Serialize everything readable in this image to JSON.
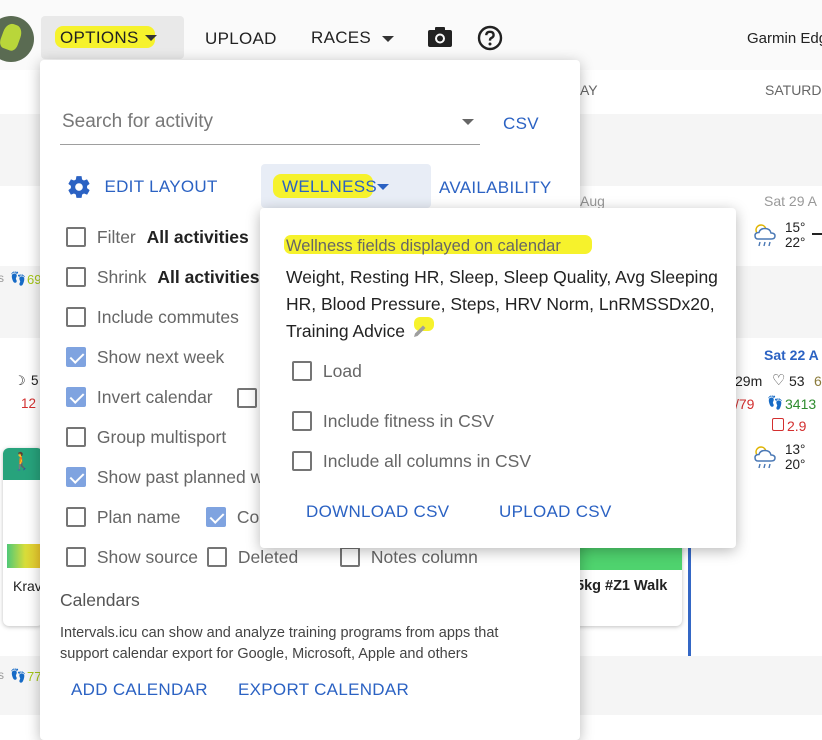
{
  "topbar": {
    "options_label": "OPTIONS",
    "upload_label": "UPLOAD",
    "races_label": "RACES",
    "device_label": "Garmin Edg"
  },
  "calendar": {
    "head_day": "AY",
    "head_saturday": "SATURD",
    "aug_label": "Aug",
    "sat29": "Sat 29 A",
    "temp_a1": "15°",
    "temp_a2": "22°",
    "sat22": "Sat 22 A",
    "row2_dur": "29m",
    "row2_hr": "53",
    "row2_6": "6",
    "row2_79": "/79",
    "row2_steps": "3413",
    "row2_29": "2.9",
    "temp_b1": "13°",
    "temp_b2": "20°",
    "left_5": "5",
    "left_12": "12",
    "left_69": "69",
    "left_77": "77",
    "left_krav": "Krav",
    "walk_label": "5kg #Z1 Walk"
  },
  "options": {
    "search_placeholder": "Search for activity",
    "csv_label": "CSV",
    "edit_layout_label": "EDIT LAYOUT",
    "wellness_label": "WELLNESS",
    "availability_label": "AVAILABILITY",
    "filter_label": "Filter",
    "filter_value": "All activities",
    "shrink_label": "Shrink",
    "shrink_value": "All activities",
    "include_commutes": "Include commutes",
    "show_next_week": "Show next week",
    "invert_calendar": "Invert calendar",
    "group_multisport": "Group multisport",
    "show_past_planned": "Show past planned w",
    "plan_name": "Plan name",
    "co_label": "Co",
    "show_source": "Show source",
    "deleted": "Deleted",
    "notes_column": "Notes column",
    "calendars_title": "Calendars",
    "calendars_help_1": "Intervals.icu can show and analyze training programs from apps that",
    "calendars_help_2": "support calendar export for Google, Microsoft, Apple and others",
    "add_calendar": "ADD CALENDAR",
    "export_calendar": "EXPORT CALENDAR"
  },
  "wellness": {
    "title": "Wellness fields displayed on calendar",
    "fields_1": "Weight, Resting HR, Sleep, Sleep Quality, Avg Sleeping",
    "fields_2": "HR, Blood Pressure, Steps, HRV Norm, LnRMSSDx20,",
    "fields_3": "Training Advice",
    "load": "Load",
    "include_fitness_csv": "Include fitness in CSV",
    "include_all_columns_csv": "Include all columns in CSV",
    "download_csv": "DOWNLOAD CSV",
    "upload_csv": "UPLOAD CSV"
  },
  "colors": {
    "accent": "#2b62c3",
    "highlight": "#f6f22c",
    "checked": "#7fa3e0"
  }
}
